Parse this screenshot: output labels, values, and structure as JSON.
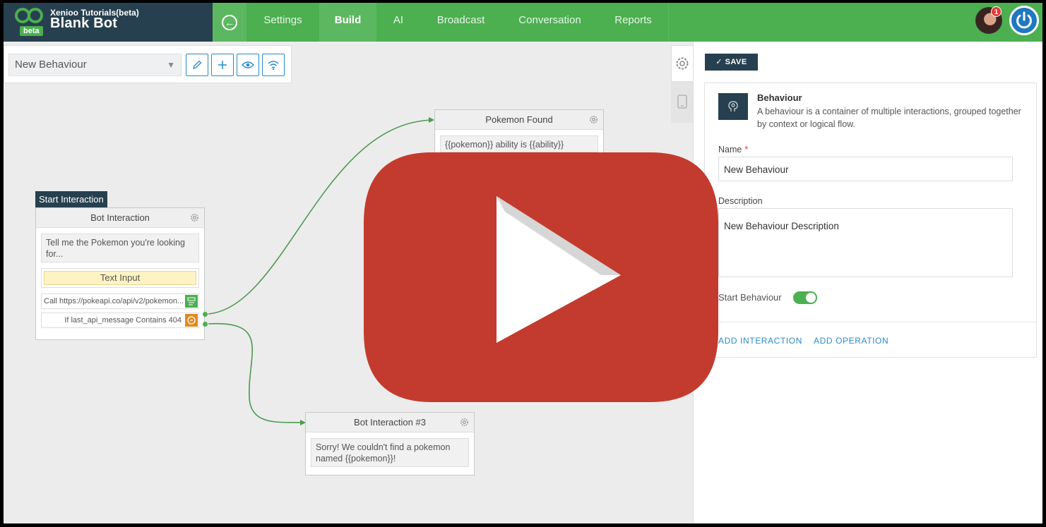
{
  "brand": {
    "subtitle": "Xenioo Tutorials(beta)",
    "title": "Blank Bot",
    "badge": "beta"
  },
  "nav": {
    "tabs": [
      {
        "label": "Settings",
        "active": false
      },
      {
        "label": "Build",
        "active": true
      },
      {
        "label": "AI",
        "active": false
      },
      {
        "label": "Broadcast",
        "active": false
      },
      {
        "label": "Conversation",
        "active": false
      },
      {
        "label": "Reports",
        "active": false
      }
    ],
    "notification_count": "1"
  },
  "toolbar": {
    "selected_behaviour": "New Behaviour"
  },
  "canvas": {
    "start_label": "Start Interaction",
    "bot_interaction": {
      "title": "Bot Interaction",
      "message": "Tell me the Pokemon you're looking for...",
      "input": "Text Input",
      "op_call": "Call https://pokeapi.co/api/v2/pokemon...",
      "op_if": "If last_api_message Contains 404"
    },
    "pokemon_found": {
      "title": "Pokemon Found",
      "message": "{{pokemon}} ability is {{ability}}"
    },
    "bot_interaction_3": {
      "title": "Bot Interaction #3",
      "message": "Sorry! We couldn't find a pokemon named {{pokemon}}!"
    }
  },
  "panel": {
    "save_label": "SAVE",
    "card_title": "Behaviour",
    "card_desc": "A behaviour is a container of multiple interactions, grouped together by context or logical flow.",
    "name_label": "Name",
    "name_required": "*",
    "name_value": "New Behaviour",
    "description_label": "Description",
    "description_value": "New Behaviour Description",
    "start_behaviour_label": "Start Behaviour",
    "start_behaviour_on": true,
    "add_interaction": "ADD INTERACTION",
    "add_operation": "ADD OPERATION"
  },
  "colors": {
    "topbar": "#4caf50",
    "brand_bg": "#27404f",
    "accent_blue": "#2a8bc9",
    "play_red": "#c33b2e"
  }
}
